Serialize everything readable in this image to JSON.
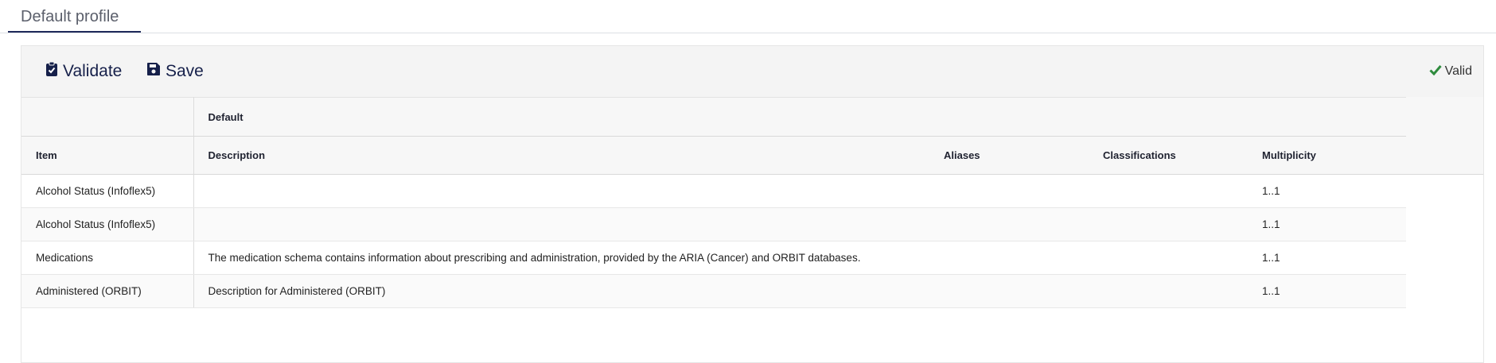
{
  "tab": {
    "label": "Default profile"
  },
  "toolbar": {
    "validate_label": "Validate",
    "save_label": "Save",
    "status_label": "Valid",
    "status_color": "#2e8b3d"
  },
  "table": {
    "group_header": "Default",
    "columns": [
      "Item",
      "Description",
      "Aliases",
      "Classifications",
      "Multiplicity"
    ],
    "rows": [
      {
        "item": "Alcohol Status (Infoflex5)",
        "description": "",
        "aliases": "",
        "classifications": "",
        "multiplicity": "1..1"
      },
      {
        "item": "Alcohol Status (Infoflex5)",
        "description": "",
        "aliases": "",
        "classifications": "",
        "multiplicity": "1..1"
      },
      {
        "item": "Medications",
        "description": "The medication schema contains information about prescribing and administration, provided by the ARIA (Cancer) and ORBIT databases.",
        "aliases": "",
        "classifications": "",
        "multiplicity": "1..1"
      },
      {
        "item": "Administered (ORBIT)",
        "description": "Description for Administered (ORBIT)",
        "aliases": "",
        "classifications": "",
        "multiplicity": "1..1"
      }
    ]
  }
}
